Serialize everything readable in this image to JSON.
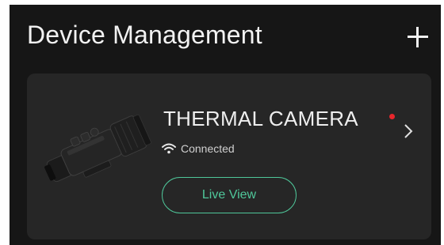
{
  "header": {
    "title": "Device Management",
    "add_icon": "plus-icon"
  },
  "device_card": {
    "name": "THERMAL CAMERA",
    "status": "Connected",
    "status_icon": "wifi-icon",
    "alert_color": "#e8262c",
    "live_view_label": "Live View",
    "accent_color": "#4fc79a",
    "chevron_icon": "chevron-right-icon",
    "image": "thermal-scope-image"
  },
  "theme": {
    "background": "#161616",
    "card_background": "#262626"
  }
}
